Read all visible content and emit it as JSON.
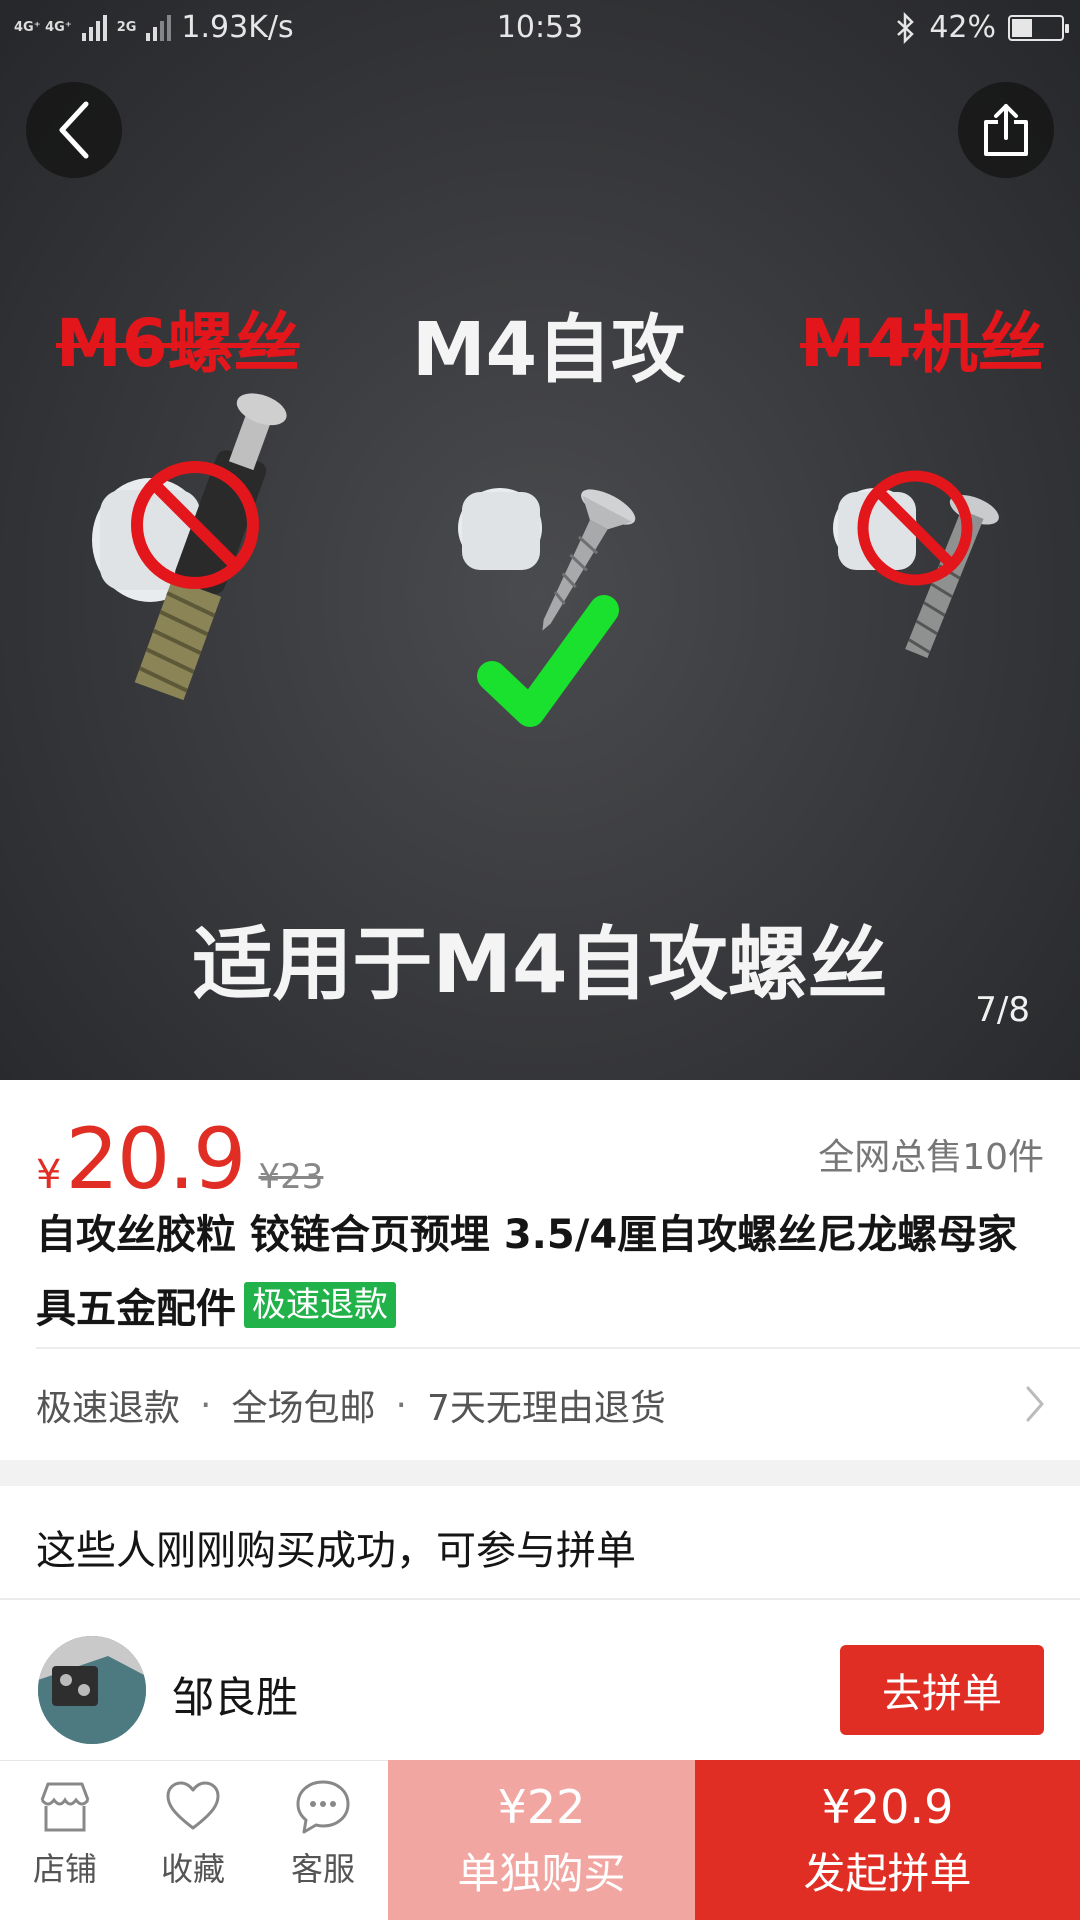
{
  "status_bar": {
    "network_1": "4G⁺ 4G⁺",
    "network_2": "2G",
    "speed": "1.93K/s",
    "time": "10:53",
    "battery": "42%",
    "battery_level": 0.42,
    "icons": [
      "signal-icon",
      "bluetooth-icon",
      "battery-icon"
    ]
  },
  "hero": {
    "label_m6": "M6螺丝",
    "label_m4_self": "M4自攻",
    "label_m4_machine": "M4机丝",
    "caption": "适用于M4自攻螺丝",
    "counter": "7/8",
    "icons": [
      "back-icon",
      "share-icon",
      "prohibited-icon",
      "check-icon"
    ]
  },
  "product": {
    "currency": "¥",
    "price": "20.9",
    "original_price": "¥23",
    "sold": "全网总售10件",
    "title": "自攻丝胶粒 铰链合页预埋 3.5/4厘自攻螺丝尼龙螺母家具五金配件",
    "tag": "极速退款"
  },
  "services": {
    "items": [
      "极速退款",
      "全场包邮",
      "7天无理由退货"
    ],
    "separator": "·"
  },
  "buyers": {
    "title": "这些人刚刚购买成功，可参与拼单",
    "rows": [
      {
        "name": "邹良胜",
        "action": "去拼单"
      }
    ]
  },
  "bottom_bar": {
    "tabs": [
      {
        "label": "店铺",
        "icon": "store-icon"
      },
      {
        "label": "收藏",
        "icon": "heart-icon"
      },
      {
        "label": "客服",
        "icon": "chat-icon"
      }
    ],
    "buy_alone": {
      "price": "¥22",
      "label": "单独购买"
    },
    "buy_group": {
      "price": "¥20.9",
      "label": "发起拼单"
    }
  },
  "colors": {
    "brand_red": "#e02e24",
    "light_red": "#f2a6a1",
    "tag_green": "#21b24a",
    "strike_red": "#e3161b",
    "check_green": "#19e12d"
  }
}
